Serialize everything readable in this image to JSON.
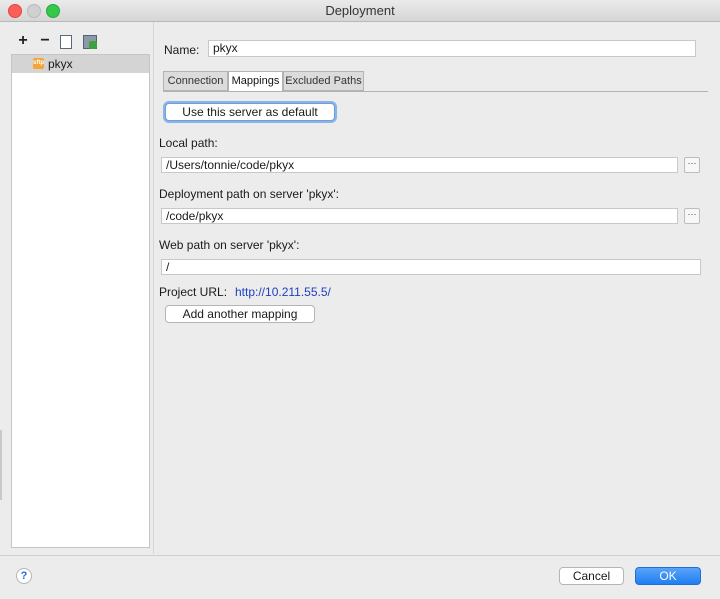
{
  "window": {
    "title": "Deployment"
  },
  "toolbar": {
    "add_label": "+",
    "remove_label": "−",
    "copy_icon": "copy-icon",
    "default_icon": "set-default-icon"
  },
  "servers": [
    {
      "label": "pkyx",
      "icon": "sftp-server-icon",
      "icon_text": "sftp",
      "selected": true
    }
  ],
  "name": {
    "label": "Name:",
    "value": "pkyx"
  },
  "tabs": [
    {
      "label": "Connection",
      "active": false
    },
    {
      "label": "Mappings",
      "active": true
    },
    {
      "label": "Excluded Paths",
      "active": false
    }
  ],
  "mappings": {
    "default_button": "Use this server as default",
    "local_path": {
      "label": "Local path:",
      "value": "/Users/tonnie/code/pkyx",
      "browse": "···"
    },
    "deployment_path": {
      "label": "Deployment path on server 'pkyx':",
      "value": "/code/pkyx",
      "browse": "···"
    },
    "web_path": {
      "label": "Web path on server 'pkyx':",
      "value": "/"
    },
    "project_url": {
      "label": "Project URL:",
      "value": "http://10.211.55.5/"
    },
    "add_mapping_button": "Add another mapping"
  },
  "footer": {
    "help_label": "?",
    "cancel_label": "Cancel",
    "ok_label": "OK"
  },
  "colors": {
    "accent": "#1f7ef3",
    "link": "#1d3fbf",
    "sftp_icon": "#f3a53a"
  }
}
